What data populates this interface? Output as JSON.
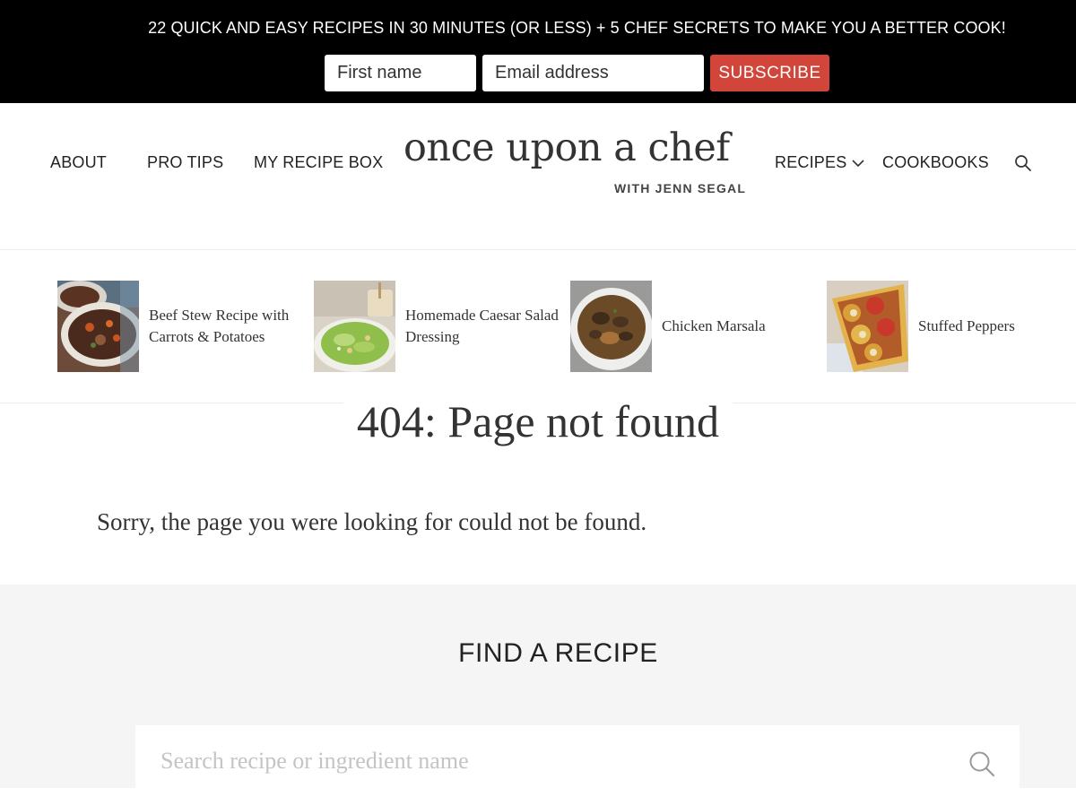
{
  "promo": {
    "text": "22 QUICK AND EASY RECIPES IN 30 MINUTES (OR LESS) + 5 CHEF SECRETS TO MAKE YOU A BETTER COOK!",
    "first_name_placeholder": "First name",
    "email_placeholder": "Email address",
    "subscribe_label": "SUBSCRIBE",
    "accent_color": "#d1453b"
  },
  "nav": {
    "left": [
      "ABOUT",
      "PRO TIPS",
      "MY RECIPE BOX"
    ],
    "recipes_label": "RECIPES",
    "cookbooks_label": "COOKBOOKS",
    "search_icon": "search-icon"
  },
  "logo": {
    "main": "once upon a chef",
    "sub": "WITH JENN SEGAL"
  },
  "featured": [
    {
      "title": "Beef Stew Recipe with Carrots & Potatoes"
    },
    {
      "title": "Homemade Caesar Salad Dressing"
    },
    {
      "title": "Chicken Marsala"
    },
    {
      "title": "Stuffed Peppers"
    }
  ],
  "main": {
    "title": "404: Page not found",
    "message": "Sorry, the page you were looking for could not be found."
  },
  "find": {
    "title": "FIND A RECIPE",
    "placeholder": "Search recipe or ingredient name"
  }
}
